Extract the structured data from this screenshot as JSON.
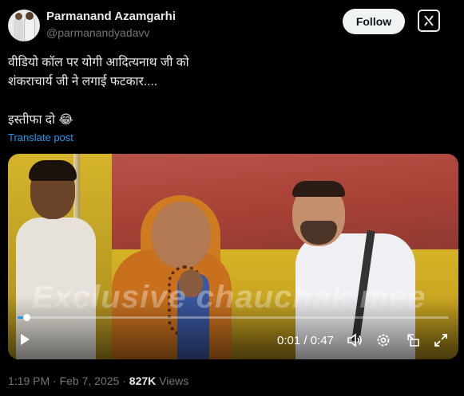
{
  "author": {
    "display_name": "Parmanand Azamgarhi",
    "handle": "@parmanandyadavv"
  },
  "header": {
    "follow_label": "Follow",
    "grok_icon": "grok-icon"
  },
  "tweet": {
    "text": "वीडियो कॉल पर योगी आदित्यनाथ जी को\nशंकराचार्य जी ने लगाई फटकार....\n\nइस्तीफा दो 😂",
    "translate_label": "Translate post"
  },
  "video": {
    "watermark": "Exclusive chauchak mee",
    "current_time": "0:01",
    "duration": "0:47",
    "time_display": "0:01 / 0:47",
    "progress": 0.02,
    "controls": [
      "play-icon",
      "volume-icon",
      "settings-icon",
      "pip-icon",
      "fullscreen-icon"
    ]
  },
  "meta": {
    "time": "1:19 PM",
    "date": "Feb 7, 2025",
    "separator": " · ",
    "views_count": "827K",
    "views_label": " Views"
  },
  "colors": {
    "background": "#000000",
    "text": "#e7e9ea",
    "muted": "#71767b",
    "link": "#1d9bf0",
    "follow_bg": "#eff3f4"
  }
}
